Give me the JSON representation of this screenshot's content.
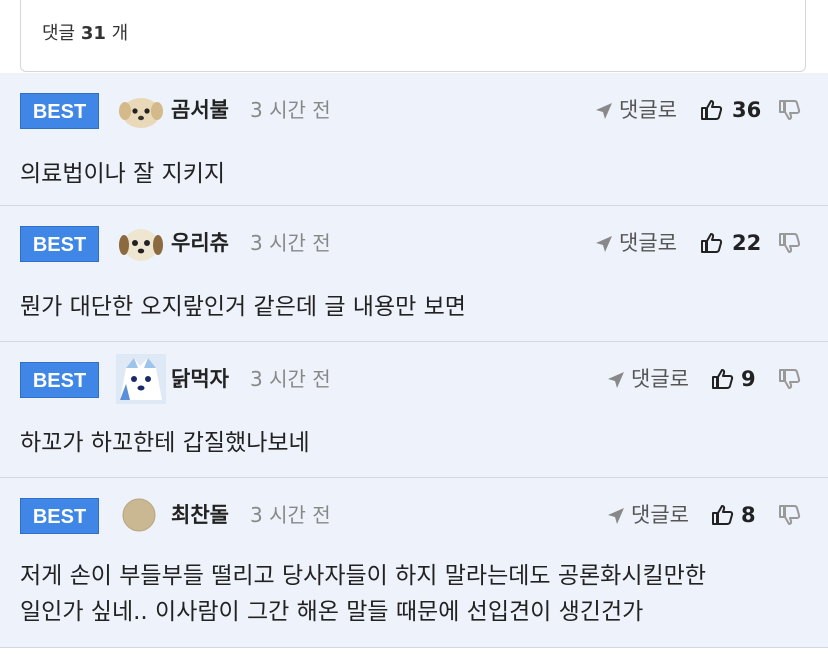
{
  "header": {
    "count_prefix": "댓글",
    "count_number": "31",
    "count_suffix": "개"
  },
  "comments": [
    {
      "badge": "BEST",
      "nickname": "곰서불",
      "time": "3 시간 전",
      "reply_label": "댓글로",
      "likes": "36",
      "text": "의료법이나 잘 지키지",
      "avatar": "puppy-avatar"
    },
    {
      "badge": "BEST",
      "nickname": "우리츄",
      "time": "3 시간 전",
      "reply_label": "댓글로",
      "likes": "22",
      "text": "뭔가 대단한 오지랖인거 같은데 글 내용만 보면",
      "avatar": "puppy-avatar"
    },
    {
      "badge": "BEST",
      "nickname": "닭먹자",
      "time": "3 시간 전",
      "reply_label": "댓글로",
      "likes": "9",
      "text": "하꼬가 하꼬한테 갑질했나보네",
      "avatar": "white-dog-avatar"
    },
    {
      "badge": "BEST",
      "nickname": "최찬돌",
      "time": "3 시간 전",
      "reply_label": "댓글로",
      "likes": "8",
      "text_line1": "저게 손이 부들부들 떨리고 당사자들이 하지 말라는데도 공론화시킬만한",
      "text_line2": "일인가 싶네.. 이사람이 그간 해온 말들 때문에 선입견이 생긴건가",
      "avatar": "beige-circle-avatar"
    }
  ],
  "colors": {
    "badge_blue": "#3f86e6",
    "row_background": "#eef2fb",
    "divider": "#d4d8e2"
  }
}
